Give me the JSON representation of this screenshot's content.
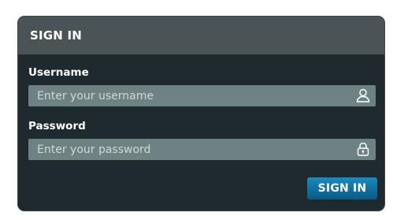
{
  "panel": {
    "title": "SIGN IN"
  },
  "username": {
    "label": "Username",
    "placeholder": "Enter your username",
    "value": "",
    "icon": "user-icon"
  },
  "password": {
    "label": "Password",
    "placeholder": "Enter your password",
    "value": "",
    "icon": "lock-icon"
  },
  "submit": {
    "label": "SIGN IN"
  },
  "colors": {
    "panel_background": "#1e2a2d",
    "header_background": "#4a5456",
    "field_background": "#6e8183",
    "button_accent": "#0f6f9e"
  }
}
